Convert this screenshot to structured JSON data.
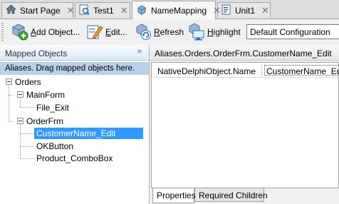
{
  "tabs": [
    {
      "label": "Start Page",
      "icon": "home-icon",
      "active": false
    },
    {
      "label": "Test1",
      "icon": "test-icon",
      "active": false
    },
    {
      "label": "NameMapping",
      "icon": "name-mapping-icon",
      "active": true
    },
    {
      "label": "Unit1",
      "icon": "unit-icon",
      "active": false
    }
  ],
  "tab_close_glyph": "✕",
  "toolbar": {
    "add_object_prefix": "A",
    "add_object_rest": "dd Object...",
    "edit_prefix": "E",
    "edit_rest": "dit...",
    "refresh_prefix": "R",
    "refresh_rest": "efresh",
    "highlight_prefix": "H",
    "highlight_rest": "ighlight",
    "configuration_value": "Default Configuration"
  },
  "left_panel": {
    "title": "Mapped Objects",
    "collapse_glyph": "»",
    "hint": "Aliases. Drag mapped objects here.",
    "tree": [
      {
        "label": "Orders",
        "expanded": true
      },
      {
        "label": "MainForm",
        "expanded": true
      },
      {
        "label": "File_Exit"
      },
      {
        "label": "OrderFrm",
        "expanded": true
      },
      {
        "label": "CustomerName_Edit",
        "selected": true
      },
      {
        "label": "OKButton"
      },
      {
        "label": "Product_ComboBox"
      }
    ]
  },
  "right_panel": {
    "path": "Aliases.Orders.OrderFrm.CustomerName_Edit",
    "properties": [
      {
        "name": "NativeDelphiObject.Name",
        "value": "CustomerName_Edit"
      }
    ],
    "bottom_tabs": [
      {
        "label": "Properties",
        "active": true
      },
      {
        "label": "Required Children",
        "active": false
      }
    ]
  },
  "colors": {
    "selection": "#3399ff",
    "hint_background": "#b9d1ea"
  }
}
